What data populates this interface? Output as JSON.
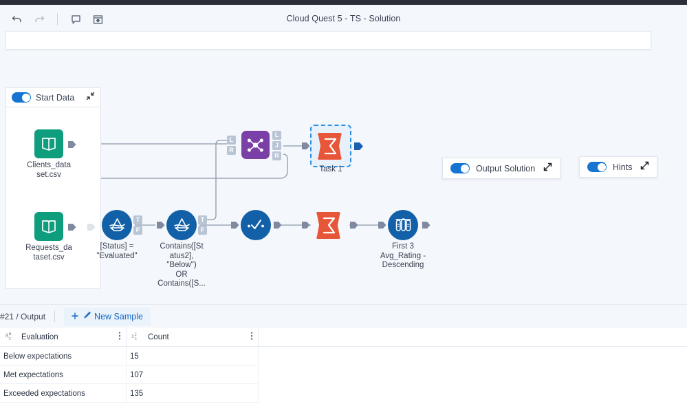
{
  "window": {
    "title": "Cloud Quest 5 - TS - Solution"
  },
  "toolbar": {
    "undo": "undo-icon",
    "redo": "redo-icon",
    "comment": "comment-icon",
    "insert": "insert-panel-icon"
  },
  "start_panel": {
    "title": "Start Data",
    "toggle_on": true,
    "collapse": "collapse-icon",
    "nodes": [
      {
        "label": "Clients_data\nset.csv",
        "icon": "book-icon",
        "color": "#0e9e7e"
      },
      {
        "label": "Requests_da\ntaset.csv",
        "icon": "book-icon",
        "color": "#0e9e7e"
      }
    ]
  },
  "chips": [
    {
      "label": "Output Solution",
      "toggle_on": true,
      "expand": "expand-icon"
    },
    {
      "label": "Hints",
      "toggle_on": true,
      "expand": "expand-icon"
    }
  ],
  "canvas": {
    "nodes": [
      {
        "id": "join",
        "label": "",
        "type": "join-tool",
        "color": "#7b3fa8"
      },
      {
        "id": "task1",
        "label": "Task 1",
        "type": "summarize-tool",
        "color": "#e8563a",
        "selected": true
      },
      {
        "id": "filter1",
        "label": "[Status] =\n\"Evaluated\"",
        "type": "filter-tool",
        "color": "#1260a8"
      },
      {
        "id": "filter2",
        "label": "Contains([St\natus2],\n\"Below\")\nOR\nContains([S...",
        "type": "filter-tool",
        "color": "#1260a8"
      },
      {
        "id": "select",
        "label": "",
        "type": "select-tool",
        "color": "#1260a8"
      },
      {
        "id": "summar2",
        "label": "",
        "type": "summarize-tool",
        "color": "#e8563a"
      },
      {
        "id": "sample",
        "label": "First 3\nAvg_Rating -\nDescending",
        "type": "sample-tool",
        "color": "#1260a8"
      }
    ],
    "port_labels": {
      "left": "L",
      "right": "R",
      "join": "J",
      "true": "T",
      "false": "F"
    }
  },
  "results": {
    "tab_label": "#21 / Output",
    "new_sample_label": "New Sample",
    "new_sample_icon": "pipette-icon",
    "columns": [
      {
        "name": "Evaluation",
        "type_glyph": "ABC",
        "type": "string"
      },
      {
        "name": "Count",
        "type_glyph": "123",
        "type": "number"
      }
    ],
    "rows": [
      {
        "evaluation": "Below expectations",
        "count": "15"
      },
      {
        "evaluation": "Met expectations",
        "count": "107"
      },
      {
        "evaluation": "Exceeded expectations",
        "count": "135"
      }
    ]
  },
  "colors": {
    "accent_blue": "#1675d1",
    "node_blue": "#1260a8",
    "node_green": "#0e9e7e",
    "node_purple": "#7b3fa8",
    "node_orange": "#e8563a",
    "canvas_bg": "#f4f7fb",
    "selection": "#2e8fe0"
  }
}
